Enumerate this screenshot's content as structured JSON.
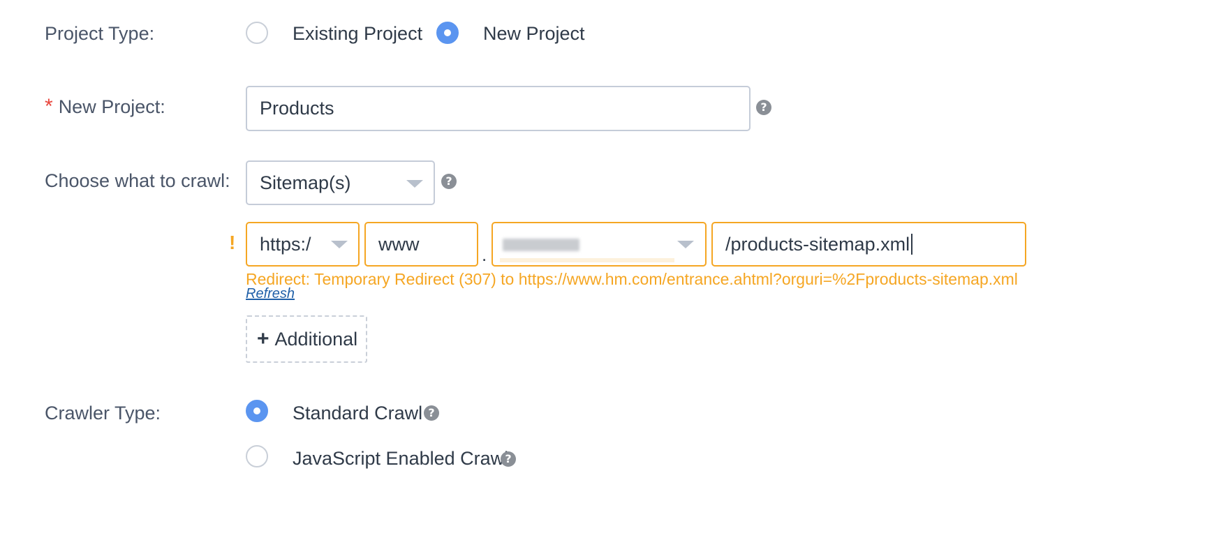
{
  "project_type": {
    "label": "Project Type:",
    "options": [
      {
        "label": "Existing Project",
        "checked": false
      },
      {
        "label": "New Project",
        "checked": true
      }
    ]
  },
  "new_project": {
    "required_mark": "*",
    "label": "New Project:",
    "value": "Products",
    "help_icon": "question-circle-icon"
  },
  "crawl_source": {
    "label": "Choose what to crawl:",
    "selected": "Sitemap(s)",
    "help_icon": "question-circle-icon"
  },
  "url_row": {
    "warning_icon": "!",
    "protocol": "https:/",
    "subdomain": "www",
    "separator": ".",
    "domain": "",
    "path": "/products-sitemap.xml",
    "warning_message": "Redirect: Temporary Redirect (307) to https://www.hm.com/entrance.ahtml?orguri=%2Fproducts-sitemap.xml",
    "refresh_link": "Refresh",
    "add_button": "Additional",
    "add_icon": "+"
  },
  "crawler_type": {
    "label": "Crawler Type:",
    "options": [
      {
        "label": "Standard Crawl",
        "checked": true
      },
      {
        "label": "JavaScript Enabled Crawl",
        "checked": false
      }
    ]
  },
  "colors": {
    "accent": "#5b95f0",
    "warning": "#f5a623",
    "required": "#e8453c",
    "link": "#1f5fa8"
  }
}
